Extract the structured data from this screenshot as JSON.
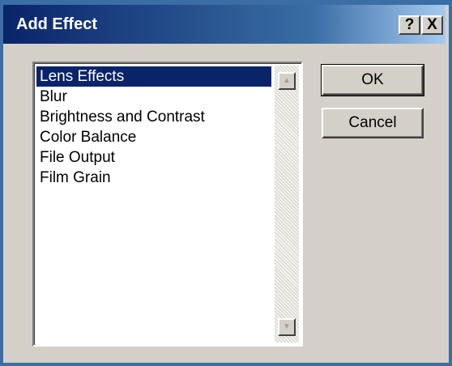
{
  "dialog": {
    "title": "Add Effect",
    "help_glyph": "?",
    "close_glyph": "X"
  },
  "effects_list": {
    "selected_index": 0,
    "items": [
      {
        "label": "Lens Effects"
      },
      {
        "label": "Blur"
      },
      {
        "label": "Brightness and Contrast"
      },
      {
        "label": "Color Balance"
      },
      {
        "label": "File Output"
      },
      {
        "label": "Film Grain"
      }
    ],
    "scroll_up_icon": "scroll-up-arrow",
    "scroll_down_icon": "scroll-down-arrow"
  },
  "buttons": {
    "ok_label": "OK",
    "cancel_label": "Cancel"
  },
  "colors": {
    "selection": "#0a246a",
    "titlebar_start": "#0a246a",
    "titlebar_end": "#a6caf0",
    "face": "#d4d0c8"
  }
}
